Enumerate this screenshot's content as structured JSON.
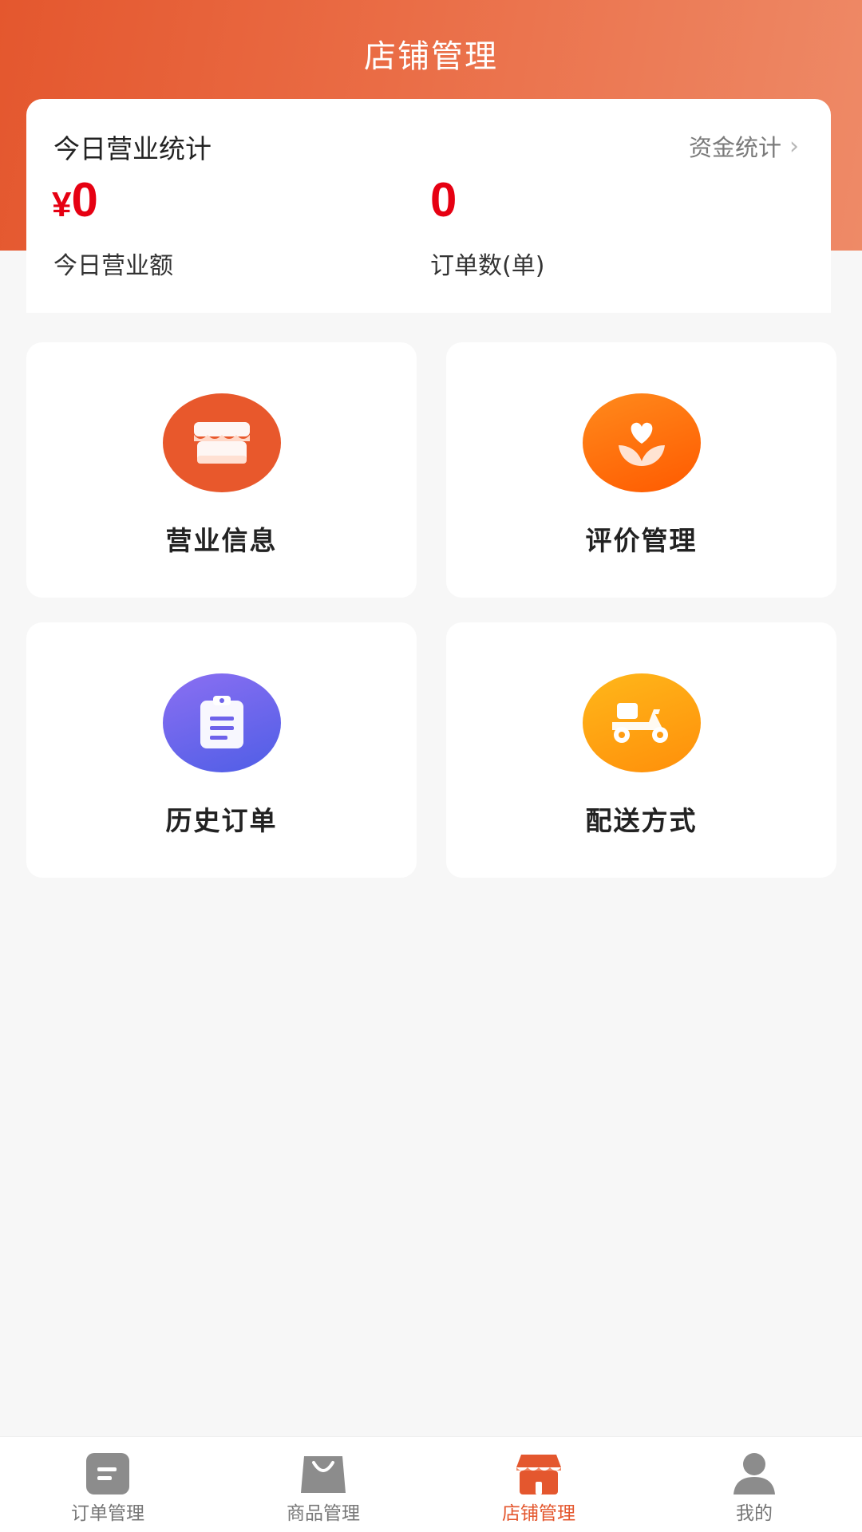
{
  "header": {
    "title": "店铺管理"
  },
  "stats": {
    "title": "今日营业统计",
    "link_label": "资金统计",
    "revenue": {
      "currency": "¥",
      "value": "0",
      "label": "今日营业额"
    },
    "orders": {
      "value": "0",
      "label": "订单数(单)"
    }
  },
  "tiles": [
    {
      "label": "营业信息",
      "icon": "shop-icon",
      "color": "#e8582c"
    },
    {
      "label": "评价管理",
      "icon": "heart-flower-icon",
      "color": "#ff6a10"
    },
    {
      "label": "历史订单",
      "icon": "clipboard-icon",
      "color": "#6e62ea"
    },
    {
      "label": "配送方式",
      "icon": "scooter-icon",
      "color": "#ffa20f"
    }
  ],
  "tabbar": {
    "active_color": "#e4572e",
    "items": [
      {
        "label": "订单管理",
        "icon": "order-doc-icon"
      },
      {
        "label": "商品管理",
        "icon": "shopping-bag-icon"
      },
      {
        "label": "店铺管理",
        "icon": "shop-icon",
        "active": true
      },
      {
        "label": "我的",
        "icon": "user-icon"
      }
    ]
  }
}
